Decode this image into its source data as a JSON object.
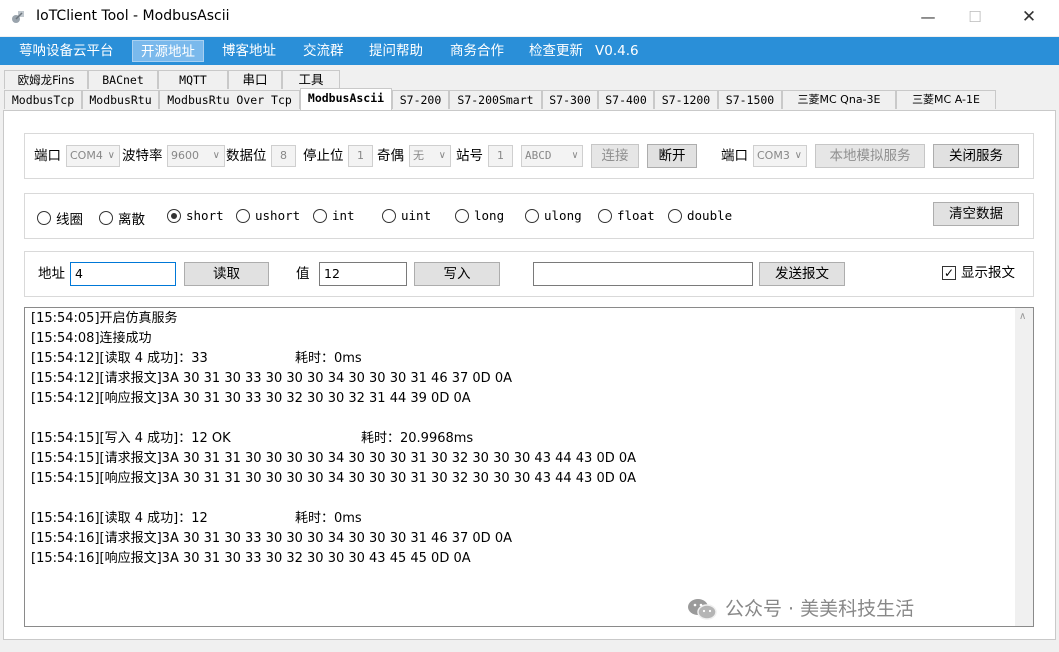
{
  "window": {
    "title": "IoTClient Tool - ModbusAscii"
  },
  "window_controls": {
    "minimize": "—",
    "maximize": "☐",
    "close": "✕"
  },
  "menu": {
    "items": [
      "萼呐设备云平台",
      "开源地址",
      "博客地址",
      "交流群",
      "提问帮助",
      "商务合作",
      "检查更新",
      "V0.4.6"
    ]
  },
  "tabs": {
    "row1": [
      "欧姆龙Fins",
      "BACnet",
      "MQTT",
      "串口",
      "工具"
    ],
    "row2": [
      "ModbusTcp",
      "ModbusRtu",
      "ModbusRtu Over Tcp",
      "ModbusAscii",
      "S7-200",
      "S7-200Smart",
      "S7-300",
      "S7-400",
      "S7-1200",
      "S7-1500",
      "三菱MC Qna-3E",
      "三菱MC A-1E"
    ],
    "selected": "ModbusAscii"
  },
  "connection": {
    "port_label": "端口",
    "port_value": "COM4",
    "baud_label": "波特率",
    "baud_value": "9600",
    "databits_label": "数据位",
    "databits_value": "8",
    "stopbits_label": "停止位",
    "stopbits_value": "1",
    "parity_label": "奇偶",
    "parity_value": "无",
    "station_label": "站号",
    "station_value": "1",
    "byteorder_value": "ABCD",
    "connect_label": "连接",
    "disconnect_label": "断开",
    "sim_port_label": "端口",
    "sim_port_value": "COM3",
    "sim_service_label": "本地模拟服务",
    "close_service_label": "关闭服务"
  },
  "datatypes": {
    "options": [
      "线圈",
      "离散",
      "short",
      "ushort",
      "int",
      "uint",
      "long",
      "ulong",
      "float",
      "double"
    ],
    "selected": "short",
    "clear_label": "清空数据"
  },
  "rw": {
    "address_label": "地址",
    "address_value": "4",
    "read_label": "读取",
    "value_label": "值",
    "value_value": "12",
    "write_label": "写入",
    "raw_value": "",
    "send_label": "发送报文",
    "show_raw_label": "显示报文",
    "show_raw_checked": true
  },
  "log": {
    "lines": [
      "[15:54:05]开启仿真服务",
      "[15:54:08]连接成功",
      "[15:54:12][读取 4 成功]：33",
      "[15:54:12][请求报文]3A 30 31 30 33 30 30 30 34 30 30 30 31 46 37 0D 0A",
      "[15:54:12][响应报文]3A 30 31 30 33 30 32 30 30 32 31 44 39 0D 0A",
      "",
      "[15:54:15][写入 4 成功]：12 OK",
      "[15:54:15][请求报文]3A 30 31 31 30 30 30 30 34 30 30 30 31 30 32 30 30 30 43 44 43 0D 0A",
      "[15:54:15][响应报文]3A 30 31 31 30 30 30 30 34 30 30 30 31 30 32 30 30 30 43 44 43 0D 0A",
      "",
      "[15:54:16][读取 4 成功]：12",
      "[15:54:16][请求报文]3A 30 31 30 33 30 30 30 34 30 30 30 31 46 37 0D 0A",
      "[15:54:16][响应报文]3A 30 31 30 33 30 32 30 30 30 43 45 45 0D 0A"
    ],
    "timings": [
      "耗时：0ms",
      "耗时：20.9968ms",
      "耗时：0ms"
    ]
  },
  "watermark": {
    "text": "公众号 · 美美科技生活"
  },
  "colors": {
    "menu_bg": "#2a8fd8",
    "focus_border": "#0078d7"
  }
}
